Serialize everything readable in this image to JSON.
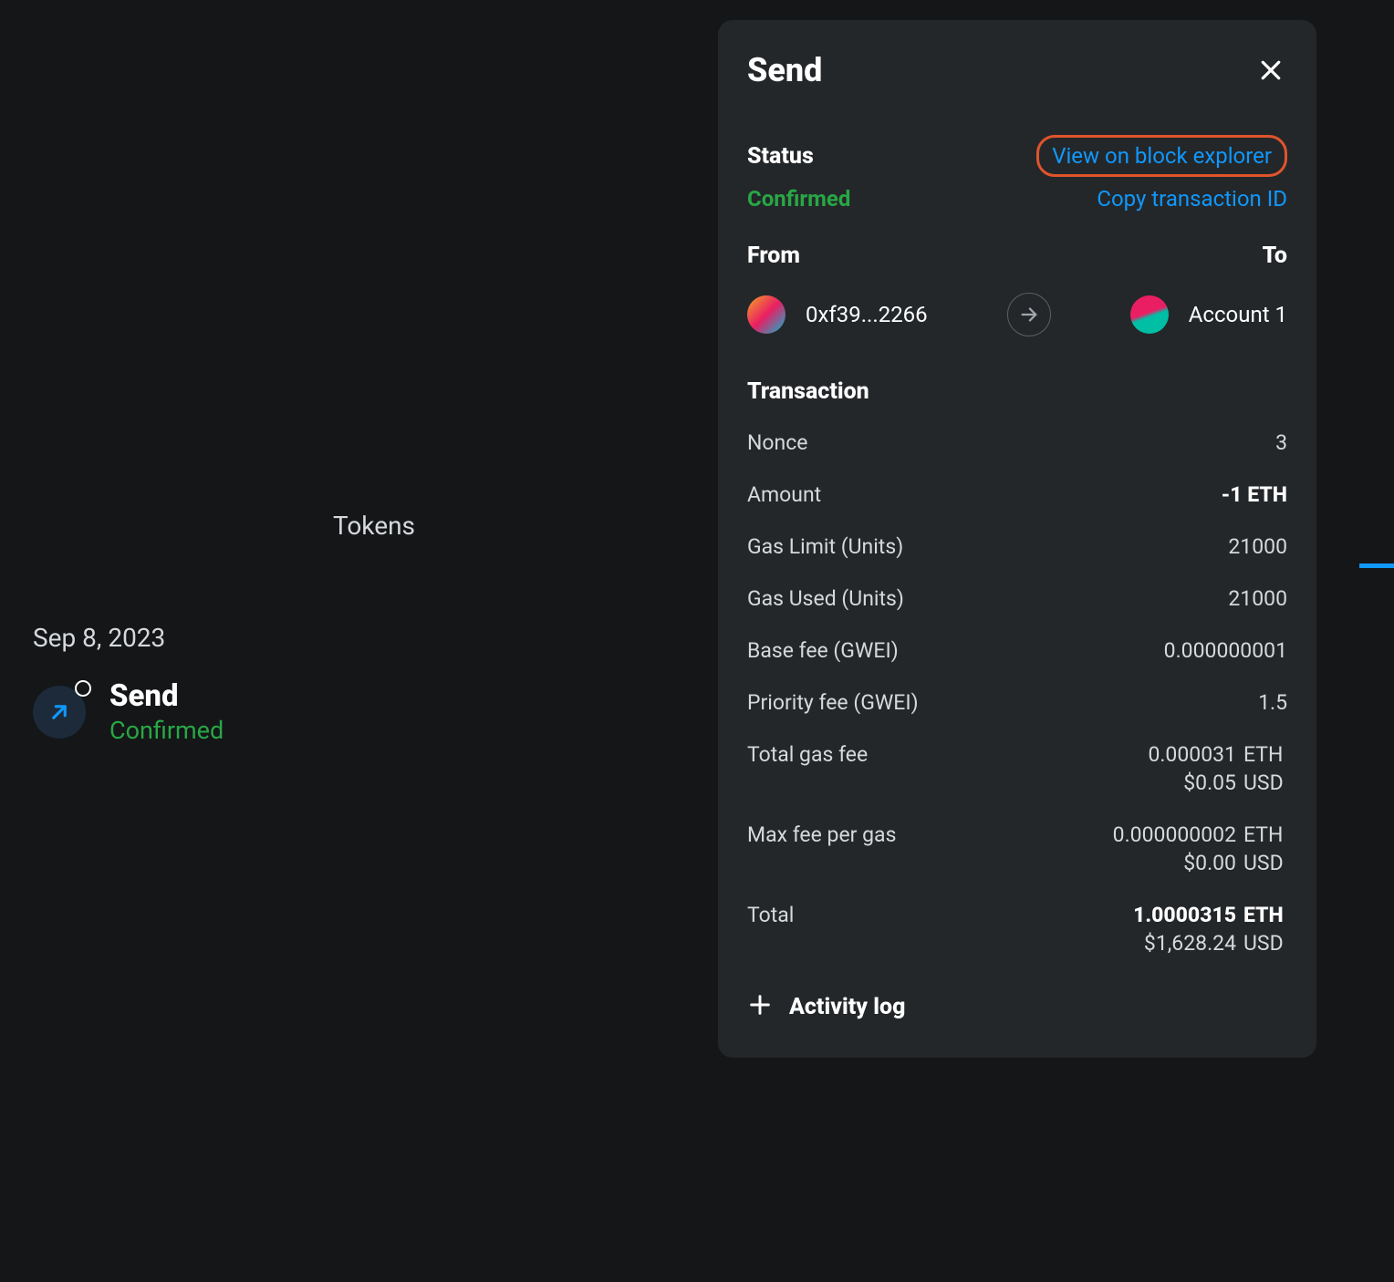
{
  "main": {
    "tokens_label": "Tokens",
    "date": "Sep 8, 2023",
    "tx_title": "Send",
    "tx_status": "Confirmed"
  },
  "panel": {
    "title": "Send",
    "status_label": "Status",
    "view_explorer": "View on block explorer",
    "confirmed": "Confirmed",
    "copy_tx": "Copy transaction ID",
    "from_label": "From",
    "to_label": "To",
    "from_addr": "0xf39...2266",
    "to_addr": "Account 1",
    "tx_section": "Transaction",
    "rows": {
      "nonce_k": "Nonce",
      "nonce_v": "3",
      "amount_k": "Amount",
      "amount_v": "-1 ETH",
      "gaslimit_k": "Gas Limit (Units)",
      "gaslimit_v": "21000",
      "gasused_k": "Gas Used (Units)",
      "gasused_v": "21000",
      "basefee_k": "Base fee (GWEI)",
      "basefee_v": "0.000000001",
      "priority_k": "Priority fee (GWEI)",
      "priority_v": "1.5",
      "totalgas_k": "Total gas fee",
      "totalgas_v1": "0.000031",
      "totalgas_u1": "ETH",
      "totalgas_v2": "$0.05",
      "totalgas_u2": "USD",
      "maxfee_k": "Max fee per gas",
      "maxfee_v1": "0.000000002",
      "maxfee_u1": "ETH",
      "maxfee_v2": "$0.00",
      "maxfee_u2": "USD",
      "total_k": "Total",
      "total_v1": "1.0000315",
      "total_u1": "ETH",
      "total_v2": "$1,628.24",
      "total_u2": "USD"
    },
    "activity_log": "Activity log"
  }
}
